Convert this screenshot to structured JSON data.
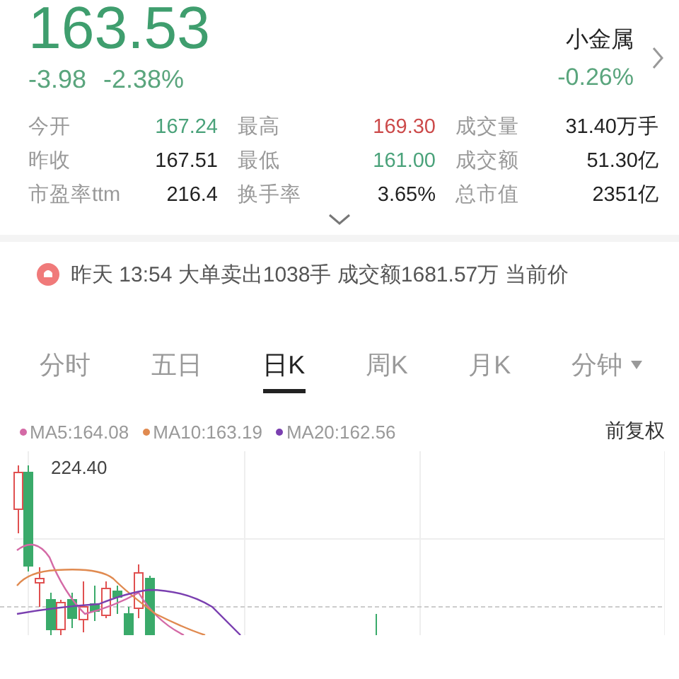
{
  "quote": {
    "price": "163.53",
    "change": "-3.98",
    "change_pct": "-2.38%",
    "sector": "小金属",
    "sector_change": "-0.26%"
  },
  "stats": [
    {
      "label": "今开",
      "value": "167.24",
      "color": "#4aa27a"
    },
    {
      "label": "最高",
      "value": "169.30",
      "color": "#cc4a4a"
    },
    {
      "label": "成交量",
      "value": "31.40万手",
      "color": "#222222"
    },
    {
      "label": "昨收",
      "value": "167.51",
      "color": "#222222"
    },
    {
      "label": "最低",
      "value": "161.00",
      "color": "#4aa27a"
    },
    {
      "label": "成交额",
      "value": "51.30亿",
      "color": "#222222"
    },
    {
      "label": "市盈率ttm",
      "value": "216.4",
      "color": "#222222"
    },
    {
      "label": "换手率",
      "value": "3.65%",
      "color": "#222222"
    },
    {
      "label": "总市值",
      "value": "2351亿",
      "color": "#222222"
    }
  ],
  "news": {
    "text": "昨天 13:54 大单卖出1038手 成交额1681.57万 当前价"
  },
  "tabs": [
    {
      "label": "分时",
      "selected": false
    },
    {
      "label": "五日",
      "selected": false
    },
    {
      "label": "日K",
      "selected": true
    },
    {
      "label": "周K",
      "selected": false
    },
    {
      "label": "月K",
      "selected": false
    },
    {
      "label": "分钟",
      "selected": false,
      "dropdown": true
    }
  ],
  "legend": [
    {
      "label": "MA5:164.08",
      "color": "#d46aa6"
    },
    {
      "label": "MA10:163.19",
      "color": "#e08a50"
    },
    {
      "label": "MA20:162.56",
      "color": "#7a3fb0"
    }
  ],
  "adjust": "前复权",
  "chart": {
    "high_label": "224.40"
  }
}
